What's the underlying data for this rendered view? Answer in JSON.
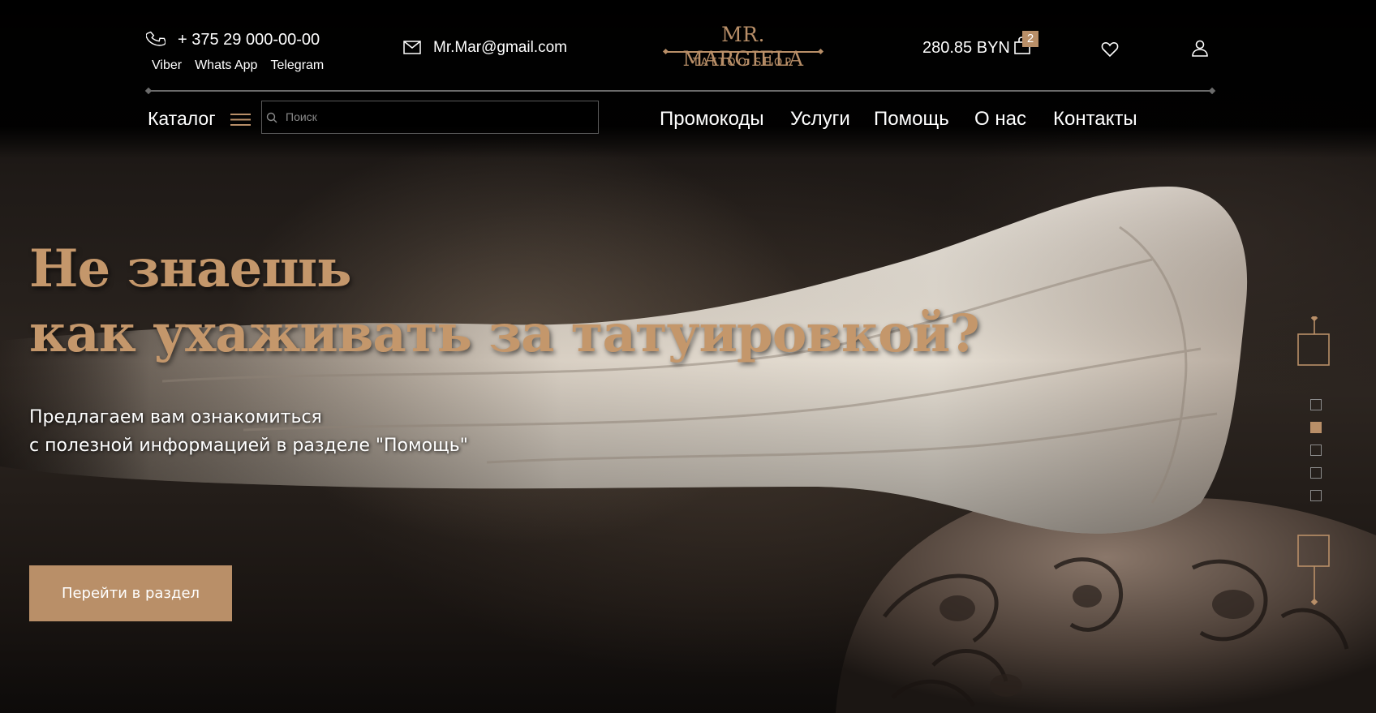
{
  "header": {
    "phone": "+ 375 29 000-00-00",
    "messengers": [
      "Viber",
      "Whats App",
      "Telegram"
    ],
    "email": "Mr.Mar@gmail.com",
    "logo": {
      "title": "MR. MARGIELA",
      "subtitle": "TATTOO SHOP"
    },
    "cart": {
      "total": "280.85 BYN",
      "count": "2"
    },
    "catalog_label": "Каталог",
    "search_placeholder": "Поиск",
    "nav": [
      "Промокоды",
      "Услуги",
      "Помощь",
      "О нас",
      "Контакты"
    ]
  },
  "hero": {
    "title_lines": [
      "Не знаешь",
      "как ухаживать за татуировкой?"
    ],
    "subtitle_lines": [
      "Предлагаем вам ознакомиться",
      "с полезной информацией в разделе \"Помощь\""
    ],
    "cta": "Перейти в раздел"
  },
  "slider": {
    "total": 5,
    "active_index": 1
  },
  "colors": {
    "accent": "#b98f68",
    "background": "#0c0a09",
    "title": "#c4976b"
  },
  "icons": [
    "phone-icon",
    "mail-icon",
    "cart-icon",
    "heart-icon",
    "user-icon",
    "burger-icon",
    "search-icon"
  ]
}
